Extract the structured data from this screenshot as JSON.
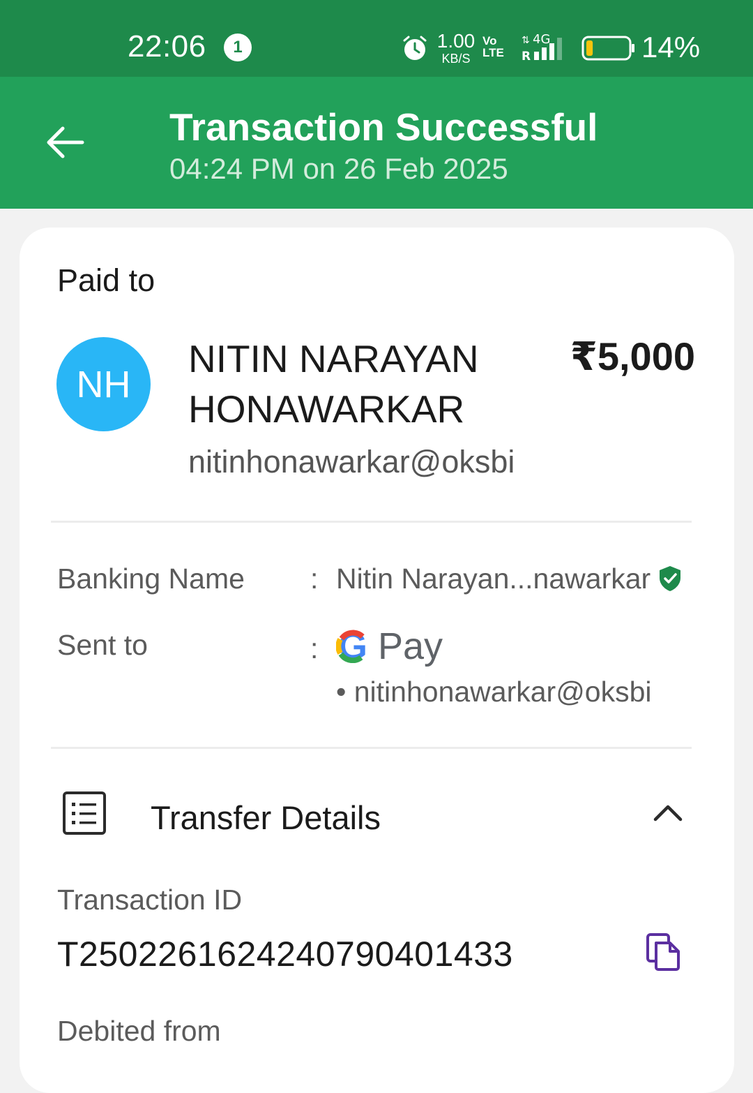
{
  "status_bar": {
    "time": "22:06",
    "notification_count": "1",
    "net_speed_value": "1.00",
    "net_speed_unit": "KB/S",
    "volte_top": "Vo",
    "volte_bottom": "LTE",
    "network_type": "4G",
    "roaming": "R",
    "battery_percent": "14%",
    "battery_level": 0.14
  },
  "header": {
    "title": "Transaction Successful",
    "subtitle": "04:24 PM on 26 Feb 2025",
    "bg_color": "#22a15a"
  },
  "payee": {
    "section_label": "Paid to",
    "avatar_initials": "NH",
    "avatar_color": "#29b6f6",
    "name_line1": "NITIN NARAYAN",
    "name_line2": "HONAWARKAR",
    "upi_id": "nitinhonawarkar@oksbi",
    "amount": "₹5,000"
  },
  "details": {
    "banking_name_label": "Banking Name",
    "banking_name_value": "Nitin Narayan...nawarkar",
    "sent_to_label": "Sent to",
    "sent_to_app_g": "G",
    "sent_to_app_name": "Pay",
    "sent_to_upi": "• nitinhonawarkar@oksbi",
    "separator": ":"
  },
  "transfer": {
    "title": "Transfer Details",
    "transaction_id_label": "Transaction ID",
    "transaction_id": "T2502261624240790401433",
    "debited_from_label": "Debited from"
  },
  "icons": {
    "back": "back-arrow-icon",
    "verified": "verified-shield-icon",
    "transfer": "receipt-list-icon",
    "collapse": "chevron-up-icon",
    "copy": "copy-icon"
  }
}
